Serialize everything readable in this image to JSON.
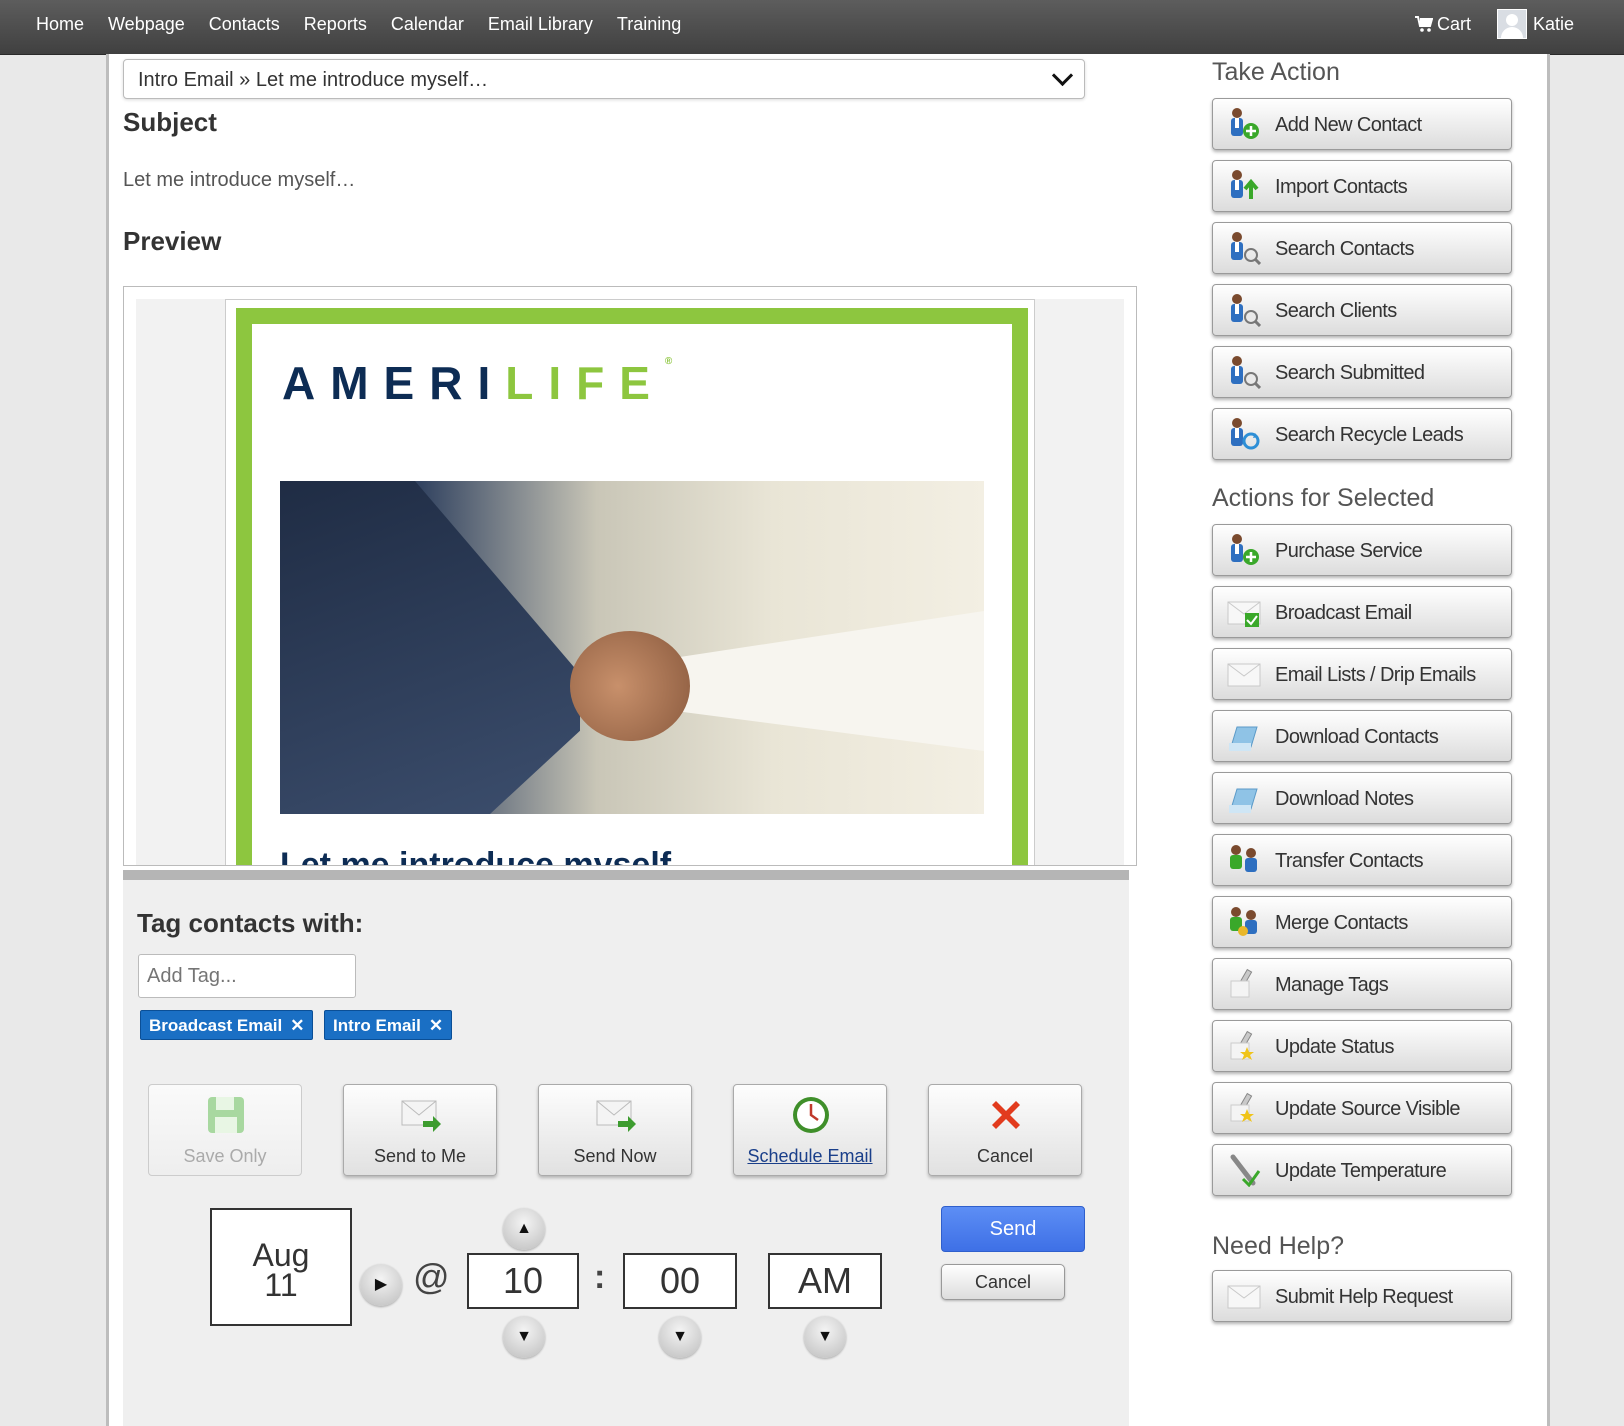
{
  "nav": {
    "items": [
      "Home",
      "Webpage",
      "Contacts",
      "Reports",
      "Calendar",
      "Email Library",
      "Training"
    ],
    "cart": "Cart",
    "user": "Katie"
  },
  "email": {
    "template_select": "Intro Email » Let me introduce myself…",
    "subject_heading": "Subject",
    "subject": "Let me introduce myself…",
    "preview_heading": "Preview",
    "preview": {
      "logo_left": "AMERI",
      "logo_right": "LIFE",
      "logo_mark": "®",
      "headline": "Let me introduce myself"
    }
  },
  "tags": {
    "heading": "Tag contacts with:",
    "placeholder": "Add Tag...",
    "chips": [
      "Broadcast Email",
      "Intro Email"
    ],
    "remove_glyph": "✕"
  },
  "actions": {
    "save_only": "Save Only",
    "send_to_me": "Send to Me",
    "send_now": "Send Now",
    "schedule_email": "Schedule Email",
    "cancel": "Cancel"
  },
  "schedule": {
    "month": "Aug",
    "day": "11",
    "at": "@",
    "hour": "10",
    "separator": ":",
    "minute": "00",
    "ampm": "AM",
    "send": "Send",
    "cancel": "Cancel"
  },
  "sidebar": {
    "take_action_heading": "Take Action",
    "take_action": [
      {
        "label": "Add New Contact",
        "icon": "add-contact-icon"
      },
      {
        "label": "Import Contacts",
        "icon": "import-contacts-icon"
      },
      {
        "label": "Search Contacts",
        "icon": "search-contacts-icon"
      },
      {
        "label": "Search Clients",
        "icon": "search-clients-icon"
      },
      {
        "label": "Search Submitted",
        "icon": "search-submitted-icon"
      },
      {
        "label": "Search Recycle Leads",
        "icon": "recycle-leads-icon"
      }
    ],
    "selected_heading": "Actions for Selected",
    "selected": [
      {
        "label": "Purchase Service",
        "icon": "purchase-service-icon"
      },
      {
        "label": "Broadcast Email",
        "icon": "broadcast-email-icon"
      },
      {
        "label": "Email Lists / Drip Emails",
        "icon": "email-lists-icon"
      },
      {
        "label": "Download Contacts",
        "icon": "download-contacts-icon"
      },
      {
        "label": "Download Notes",
        "icon": "download-notes-icon"
      },
      {
        "label": "Transfer Contacts",
        "icon": "transfer-contacts-icon"
      },
      {
        "label": "Merge Contacts",
        "icon": "merge-contacts-icon"
      },
      {
        "label": "Manage Tags",
        "icon": "manage-tags-icon"
      },
      {
        "label": "Update Status",
        "icon": "update-status-icon"
      },
      {
        "label": "Update Source Visible",
        "icon": "update-source-icon"
      },
      {
        "label": "Update Temperature",
        "icon": "update-temperature-icon"
      }
    ],
    "help_heading": "Need Help?",
    "help": [
      {
        "label": "Submit Help Request",
        "icon": "help-request-icon"
      }
    ]
  },
  "colors": {
    "brand_navy": "#0d2c54",
    "brand_green": "#8dc63f",
    "tag_blue": "#1a6fc4",
    "send_blue": "#3e70e6"
  }
}
